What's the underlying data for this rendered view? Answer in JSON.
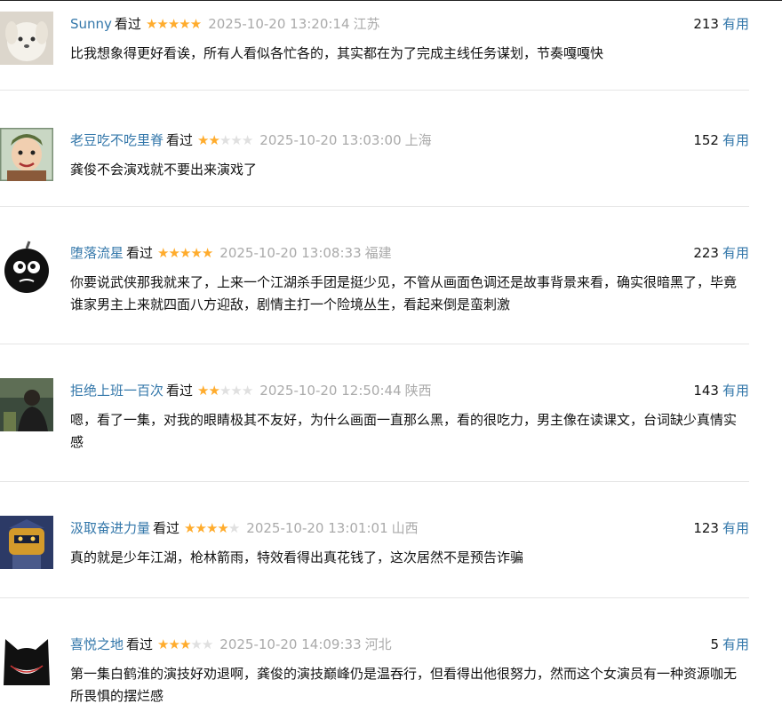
{
  "watched_label": "看过",
  "useful_label": "有用",
  "colors": {
    "author": "#3377aa",
    "star_on": "#ffac2d",
    "star_off": "#e0e0e0",
    "meta": "#aaaaaa"
  },
  "comments": [
    {
      "author": "Sunny",
      "rating": 5,
      "time": "2025-10-20 13:20:14",
      "location": "江苏",
      "votes": "213",
      "text": "比我想象得更好看诶，所有人看似各忙各的，其实都在为了完成主线任务谋划，节奏嘎嘎快",
      "avatar": "white-dog-avatar"
    },
    {
      "author": "老豆吃不吃里脊",
      "rating": 2,
      "time": "2025-10-20 13:03:00",
      "location": "上海",
      "votes": "152",
      "text": "龚俊不会演戏就不要出来演戏了",
      "avatar": "illustrated-face-avatar"
    },
    {
      "author": "堕落流星",
      "rating": 5,
      "time": "2025-10-20 13:08:33",
      "location": "福建",
      "votes": "223",
      "text": "你要说武侠那我就来了，上来一个江湖杀手团是挺少见，不管从画面色调还是故事背景来看，确实很暗黑了，毕竟谁家男主上来就四面八方迎敌，剧情主打一个险境丛生，看起来倒是蛮刺激",
      "avatar": "black-bomb-avatar"
    },
    {
      "author": "拒绝上班一百次",
      "rating": 2,
      "time": "2025-10-20 12:50:44",
      "location": "陕西",
      "votes": "143",
      "text": "嗯，看了一集，对我的眼睛极其不友好，为什么画面一直那么黑，看的很吃力，男主像在读课文，台词缺少真情实感",
      "avatar": "outdoor-person-avatar"
    },
    {
      "author": "汲取奋进力量",
      "rating": 4,
      "time": "2025-10-20 13:01:01",
      "location": "山西",
      "votes": "123",
      "text": "真的就是少年江湖，枪林箭雨，特效看得出真花钱了，这次居然不是预告诈骗",
      "avatar": "robot-avatar"
    },
    {
      "author": "喜悦之地",
      "rating": 3,
      "time": "2025-10-20 14:09:33",
      "location": "河北",
      "votes": "5",
      "text": "第一集白鹤淮的演技好劝退啊，龚俊的演技巅峰仍是温吞行，但看得出他很努力，然而这个女演员有一种资源咖无所畏惧的摆烂感",
      "avatar": "black-cat-grin-avatar"
    }
  ]
}
